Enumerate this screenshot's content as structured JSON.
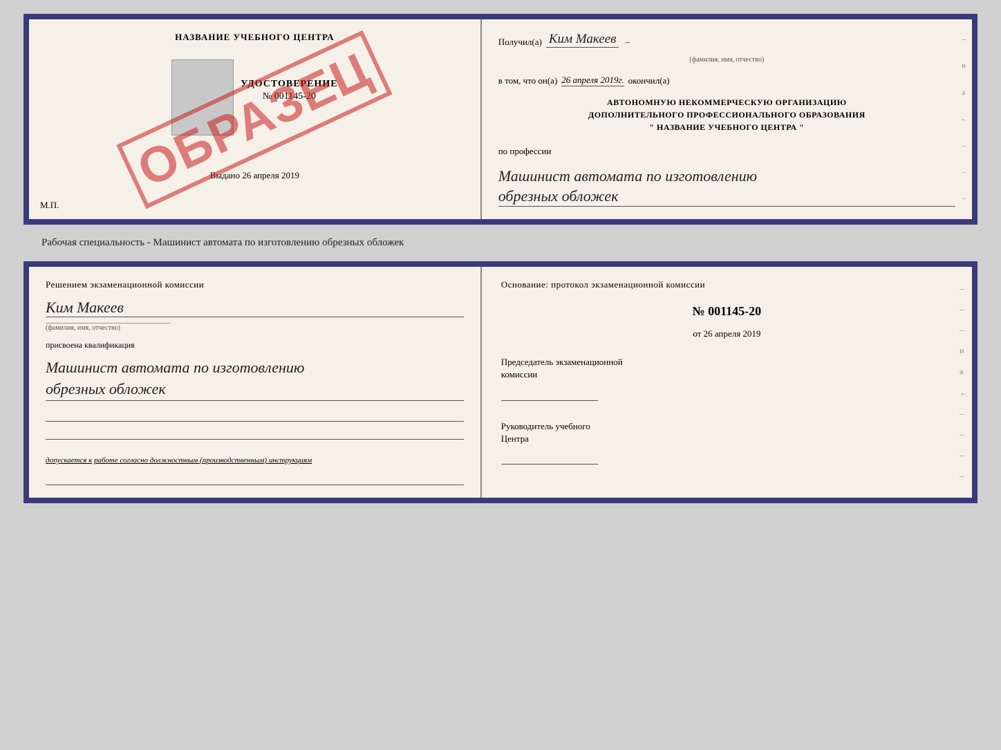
{
  "top_doc": {
    "left": {
      "school_name": "НАЗВАНИЕ УЧЕБНОГО ЦЕНТРА",
      "udostoverenie": "УДОСТОВЕРЕНИЕ",
      "number": "№ 001145-20",
      "vydano": "Выдано",
      "vydano_date": "26 апреля 2019",
      "mp": "М.П.",
      "stamp": "ОБРАЗЕЦ"
    },
    "right": {
      "poluchil_label": "Получил(а)",
      "poluchil_name": "Ким Макеев",
      "fio_subtitle": "(фамилия, имя, отчество)",
      "vtom_label": "в том, что он(а)",
      "vtom_date": "26 апреля 2019г.",
      "okonchil": "окончил(а)",
      "org_line1": "АВТОНОМНУЮ НЕКОММЕРЧЕСКУЮ ОРГАНИЗАЦИЮ",
      "org_line2": "ДОПОЛНИТЕЛЬНОГО ПРОФЕССИОНАЛЬНОГО ОБРАЗОВАНИЯ",
      "org_line3": "\"  НАЗВАНИЕ УЧЕБНОГО ЦЕНТРА  \"",
      "po_professii": "по профессии",
      "profession_line1": "Машинист автомата по изготовлению",
      "profession_line2": "обрезных обложек"
    }
  },
  "caption": "Рабочая специальность - Машинист автомата по изготовлению обрезных обложек",
  "bottom_doc": {
    "left": {
      "resheniem": "Решением экзаменационной комиссии",
      "name": "Ким Макеев",
      "fio_subtitle": "(фамилия, имя, отчество)",
      "prisvoena": "присвоена квалификация",
      "qualification_line1": "Машинист автомата по изготовлению",
      "qualification_line2": "обрезных обложек",
      "dopuskaetsya_label": "допускается к",
      "dopuskaetsya_text": "работе согласно должностным (производственным) инструкциям"
    },
    "right": {
      "osnovanie": "Основание: протокол экзаменационной комиссии",
      "number": "№  001145-20",
      "ot_label": "от",
      "ot_date": "26 апреля 2019",
      "predsedatel_line1": "Председатель экзаменационной",
      "predsedatel_line2": "комиссии",
      "rukovoditel_line1": "Руководитель учебного",
      "rukovoditel_line2": "Центра"
    }
  },
  "sidebar_marks": [
    "-",
    "и",
    "а",
    "←",
    "-",
    "-",
    "-"
  ]
}
